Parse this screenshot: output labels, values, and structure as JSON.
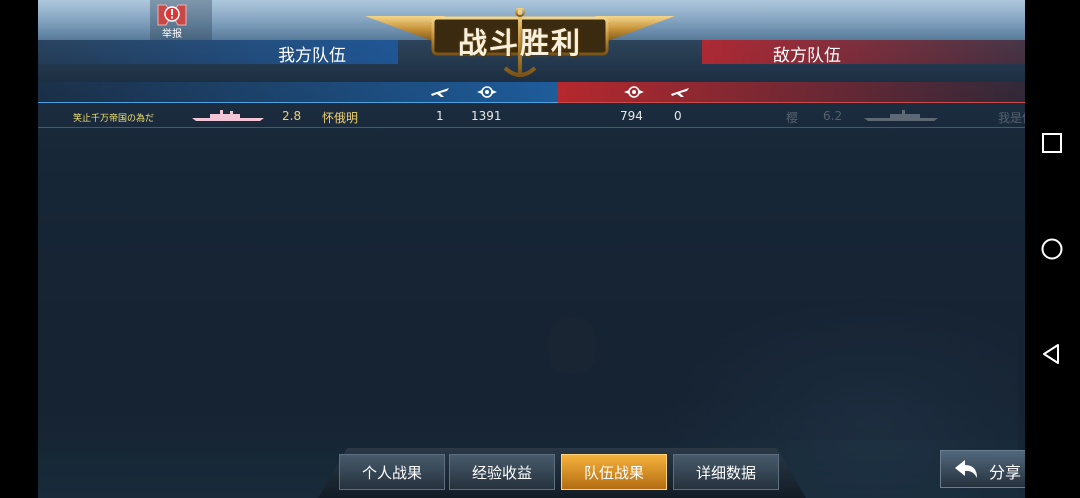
{
  "title": "战斗胜利",
  "report_label": "举报",
  "teams": {
    "ours_label": "我方队伍",
    "enemy_label": "敌方队伍"
  },
  "close_glyph": "✕",
  "columns": {
    "ours": [
      "plane-icon",
      "medal-icon"
    ],
    "enemy": [
      "medal-icon",
      "plane-icon"
    ]
  },
  "row": {
    "player_name": "笑止千万帝国の為だ",
    "player_level": "2.8",
    "ship_name": "怀俄明",
    "player_kills": "1",
    "player_score": "1391",
    "enemy_score": "794",
    "enemy_kills": "0",
    "enemy_ship_name": "樱",
    "enemy_level": "6.2",
    "enemy_player_name": "我是你爹"
  },
  "tabs": [
    {
      "label": "个人战果",
      "active": false
    },
    {
      "label": "经验收益",
      "active": false
    },
    {
      "label": "队伍战果",
      "active": true
    },
    {
      "label": "详细数据",
      "active": false
    }
  ],
  "share_label": "分享",
  "system_nav": [
    "recent-apps-icon",
    "home-icon",
    "back-icon"
  ],
  "colors": {
    "ally_blue": "#2a6fb8",
    "enemy_red": "#c0303a",
    "gold": "#d8a94a",
    "active_tab": "#e89a2a"
  }
}
